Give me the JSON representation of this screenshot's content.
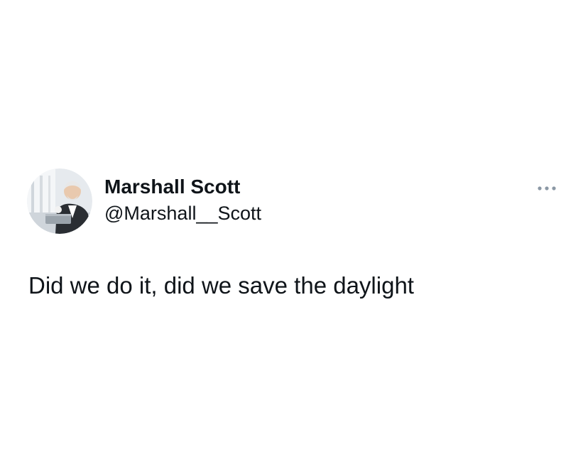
{
  "tweet": {
    "author": {
      "display_name": "Marshall Scott",
      "handle": "@Marshall__Scott"
    },
    "text": "Did we do it, did we save the daylight",
    "more_icon": "more-horizontal-icon"
  },
  "colors": {
    "text": "#0f1419",
    "icon": "#8b98a5",
    "background": "#ffffff"
  }
}
